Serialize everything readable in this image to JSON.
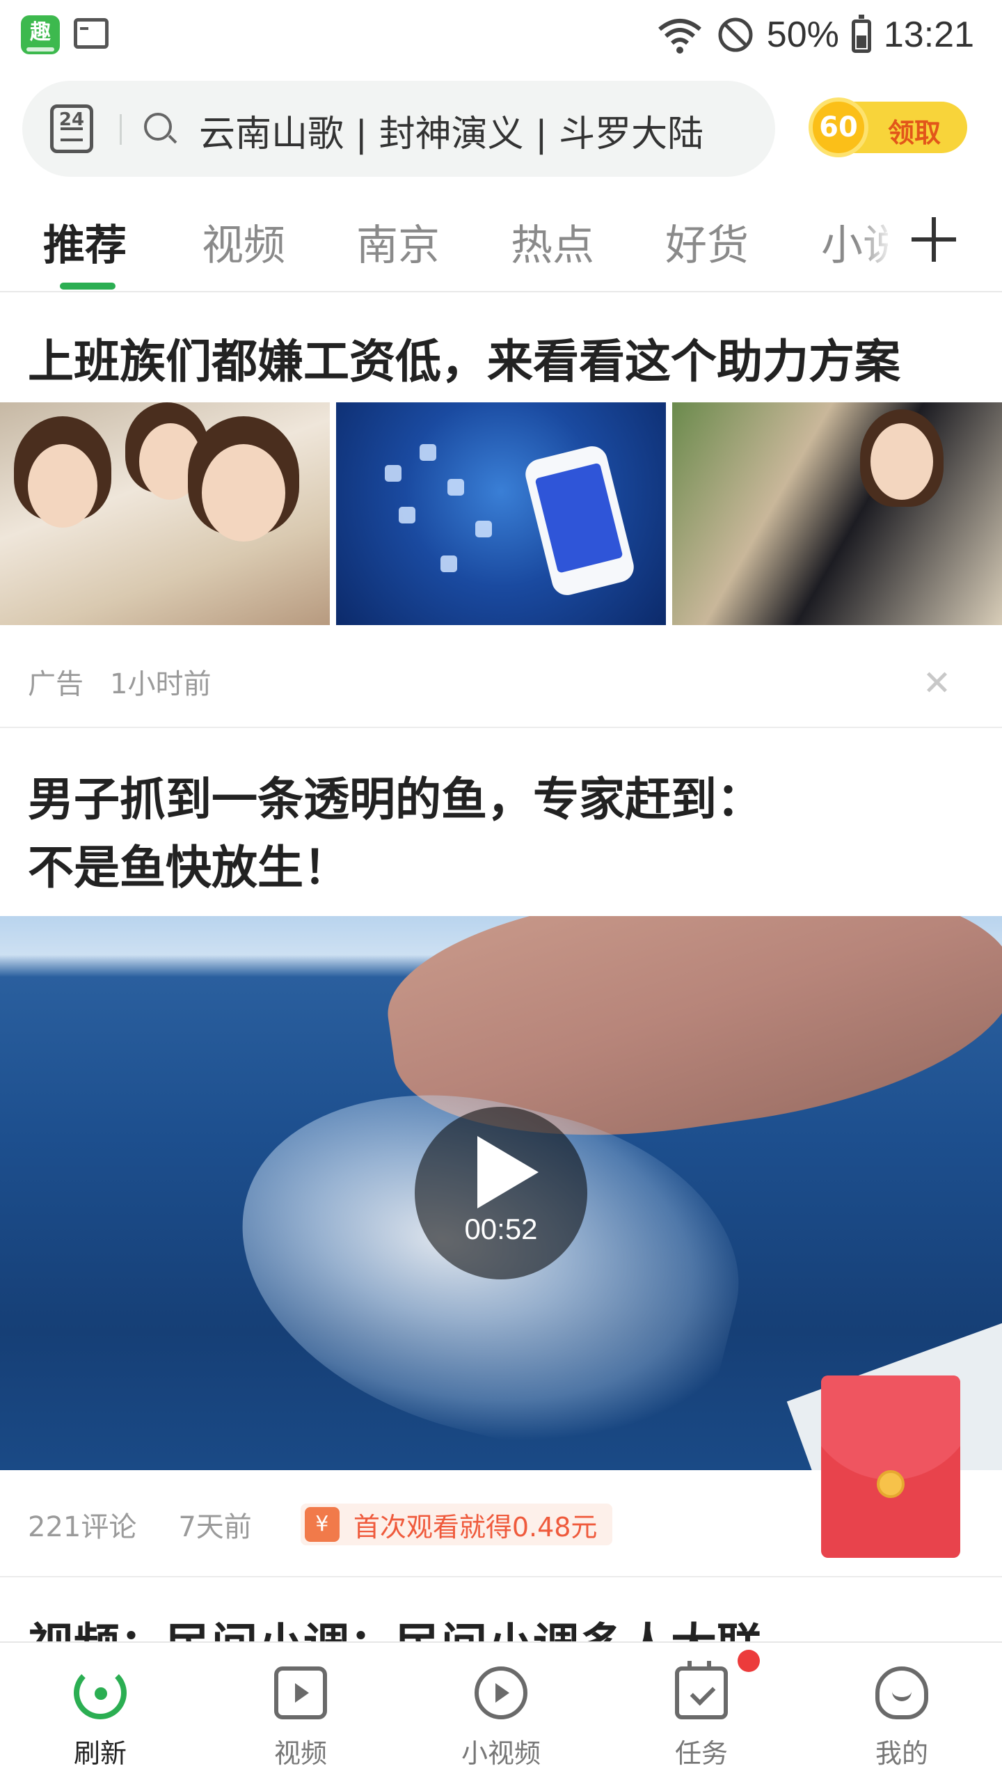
{
  "status_bar": {
    "app_icon_label": "趣",
    "battery_percent": "50%",
    "time": "13:21",
    "icons": [
      "app-icon",
      "terminal-icon",
      "wifi-icon",
      "do-not-disturb-icon",
      "battery-icon"
    ]
  },
  "search": {
    "calendar_label": "24",
    "placeholder": "云南山歌 | 封神演义 | 斗罗大陆",
    "coin_value": "60",
    "coin_action": "领取"
  },
  "tabs": [
    {
      "label": "推荐",
      "active": true
    },
    {
      "label": "视频",
      "active": false
    },
    {
      "label": "南京",
      "active": false
    },
    {
      "label": "热点",
      "active": false
    },
    {
      "label": "好货",
      "active": false
    },
    {
      "label": "小说",
      "active": false
    }
  ],
  "feed": {
    "ad": {
      "title": "上班族们都嫌工资低，来看看这个助力方案",
      "tag": "广告",
      "time": "1小时前"
    },
    "video_news": {
      "title_line1": "男子抓到一条透明的鱼，专家赶到：",
      "title_line2": "不是鱼快放生！",
      "duration": "00:52",
      "comments": "221评论",
      "time": "7天前",
      "reward_icon": "¥",
      "reward_text": "首次观看就得0.48元"
    },
    "next_title": "视频：民间小调：民间小调多人大联"
  },
  "bottom_nav": [
    {
      "label": "刷新",
      "icon": "refresh-icon",
      "active": true
    },
    {
      "label": "视频",
      "icon": "video-icon",
      "active": false
    },
    {
      "label": "小视频",
      "icon": "short-video-icon",
      "active": false
    },
    {
      "label": "任务",
      "icon": "task-icon",
      "active": false
    },
    {
      "label": "我的",
      "icon": "me-icon",
      "active": false
    }
  ],
  "colors": {
    "accent_green": "#2bae52",
    "reward_orange": "#ef5a3c",
    "coin_yellow": "#f8d43a",
    "envelope_red": "#e8434c"
  }
}
